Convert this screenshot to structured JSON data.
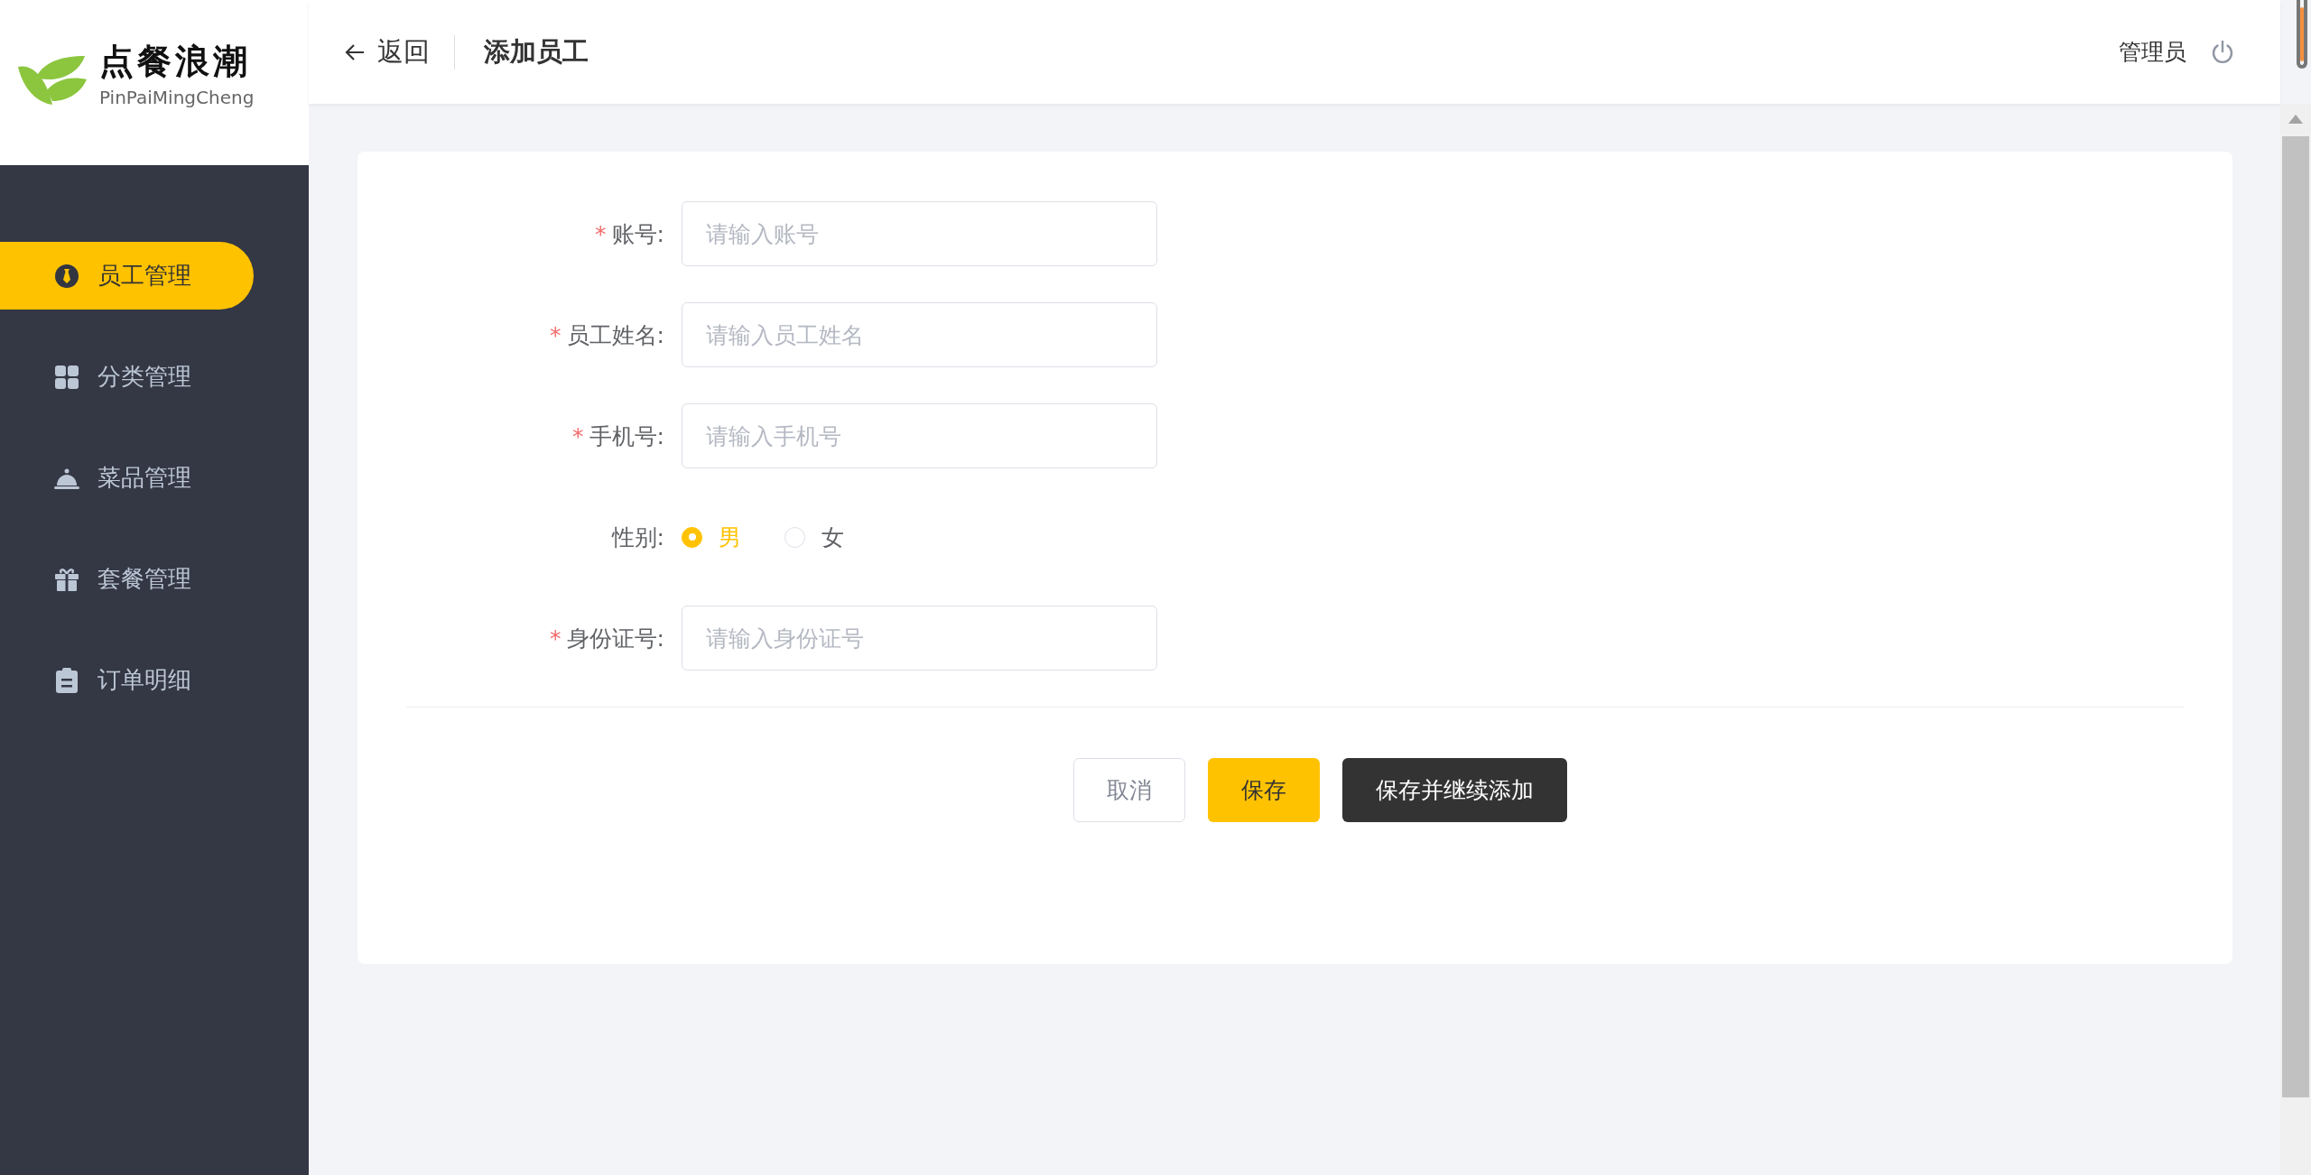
{
  "logo": {
    "title": "点餐浪潮",
    "subtitle": "PinPaiMingCheng"
  },
  "sidebar": {
    "items": [
      {
        "label": "员工管理",
        "selected": true
      },
      {
        "label": "分类管理",
        "selected": false
      },
      {
        "label": "菜品管理",
        "selected": false
      },
      {
        "label": "套餐管理",
        "selected": false
      },
      {
        "label": "订单明细",
        "selected": false
      }
    ]
  },
  "header": {
    "back": "返回",
    "title": "添加员工",
    "user": "管理员"
  },
  "form": {
    "fields": [
      {
        "kind": "input",
        "required_mark": "*",
        "label": "账号:",
        "placeholder": "请输入账号"
      },
      {
        "kind": "input",
        "required_mark": "*",
        "label": "员工姓名:",
        "placeholder": "请输入员工姓名"
      },
      {
        "kind": "input",
        "required_mark": "*",
        "label": "手机号:",
        "placeholder": "请输入手机号"
      },
      {
        "kind": "radio",
        "label": "性别:",
        "options": [
          {
            "label": "男",
            "selected": true
          },
          {
            "label": "女",
            "selected": false
          }
        ]
      },
      {
        "kind": "input",
        "required_mark": "*",
        "label": "身份证号:",
        "placeholder": "请输入身份证号"
      }
    ],
    "buttons": [
      {
        "kind": "plain",
        "label": "取消"
      },
      {
        "kind": "primary",
        "label": "保存"
      },
      {
        "kind": "dark",
        "label": "保存并继续添加"
      }
    ]
  }
}
